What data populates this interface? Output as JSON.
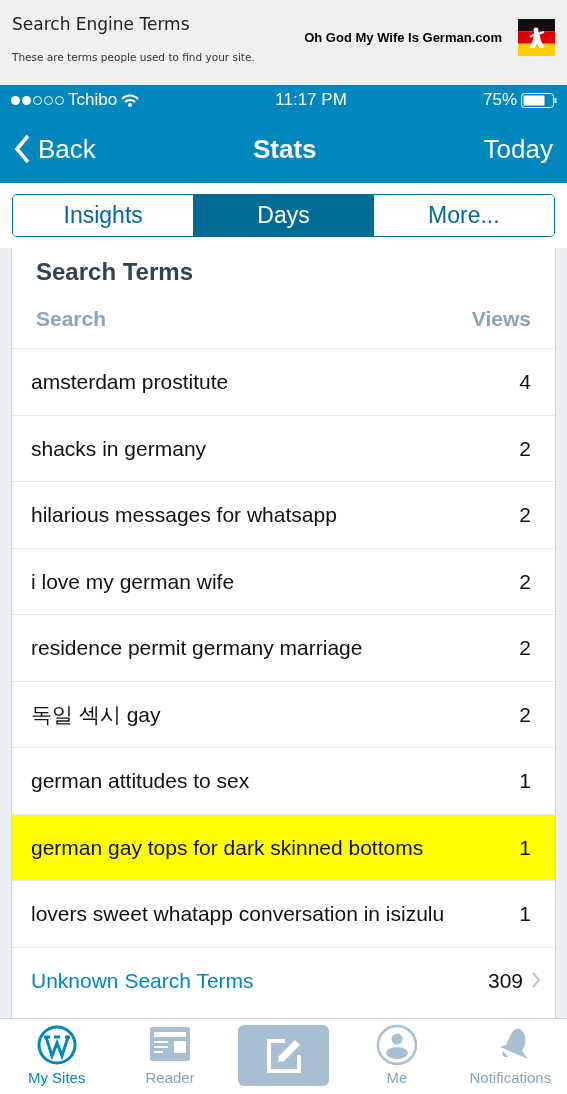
{
  "banner": {
    "title": "Search Engine Terms",
    "subtitle": "These are terms people used to find your site.",
    "site": "Oh God My Wife Is German.com"
  },
  "status_bar": {
    "carrier": "Tchibo",
    "time": "11:17 PM",
    "battery": "75%"
  },
  "nav": {
    "back": "Back",
    "title": "Stats",
    "right": "Today"
  },
  "tabs": [
    {
      "label": "Insights",
      "selected": false
    },
    {
      "label": "Days",
      "selected": true
    },
    {
      "label": "More...",
      "selected": false
    }
  ],
  "card": {
    "title": "Search Terms",
    "columns": [
      "Search",
      "Views"
    ],
    "rows": [
      {
        "term": "amsterdam prostitute",
        "views": "4",
        "highlighted": false
      },
      {
        "term": "shacks in germany",
        "views": "2",
        "highlighted": false
      },
      {
        "term": "hilarious messages for whatsapp",
        "views": "2",
        "highlighted": false
      },
      {
        "term": "i love my german wife",
        "views": "2",
        "highlighted": false
      },
      {
        "term": "residence permit germany marriage",
        "views": "2",
        "highlighted": false
      },
      {
        "term": "독일 섹시 gay",
        "views": "2",
        "highlighted": false
      },
      {
        "term": "german attitudes to sex",
        "views": "1",
        "highlighted": false
      },
      {
        "term": "german gay tops for dark skinned bottoms",
        "views": "1",
        "highlighted": true
      },
      {
        "term": "lovers sweet whatapp conversation in isizulu",
        "views": "1",
        "highlighted": false
      }
    ],
    "footer": {
      "label": "Unknown Search Terms",
      "count": "309"
    }
  },
  "tab_bar": [
    {
      "kind": "sites",
      "label": "My Sites",
      "selected": true
    },
    {
      "kind": "reader",
      "label": "Reader",
      "selected": false
    },
    {
      "kind": "write",
      "selected": false
    },
    {
      "kind": "me",
      "label": "Me",
      "selected": false
    },
    {
      "kind": "notifications",
      "label": "Notifications",
      "selected": false
    }
  ]
}
